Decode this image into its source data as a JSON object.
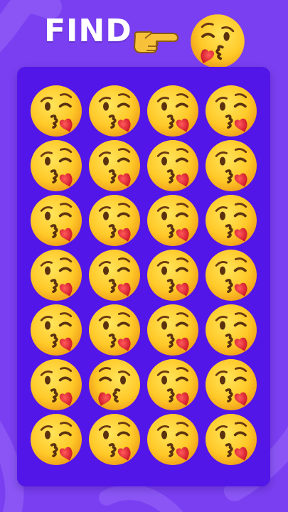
{
  "header": {
    "title": "FIND",
    "pointer_icon": "backhand-index-pointing-right",
    "target_icon": "kissing-face-with-heart-mirrored"
  },
  "colors": {
    "background": "#7a3ff0",
    "board": "#5216e8",
    "emoji_face": "#ffcb2e",
    "heart": "#e0162b"
  },
  "grid": {
    "rows": 7,
    "columns": 4,
    "default_emoji": "face-blowing-a-kiss",
    "odd_one_out_emoji": "face-blowing-a-kiss-mirrored",
    "odd_one_out_row": 6,
    "odd_one_out_column": 2
  }
}
